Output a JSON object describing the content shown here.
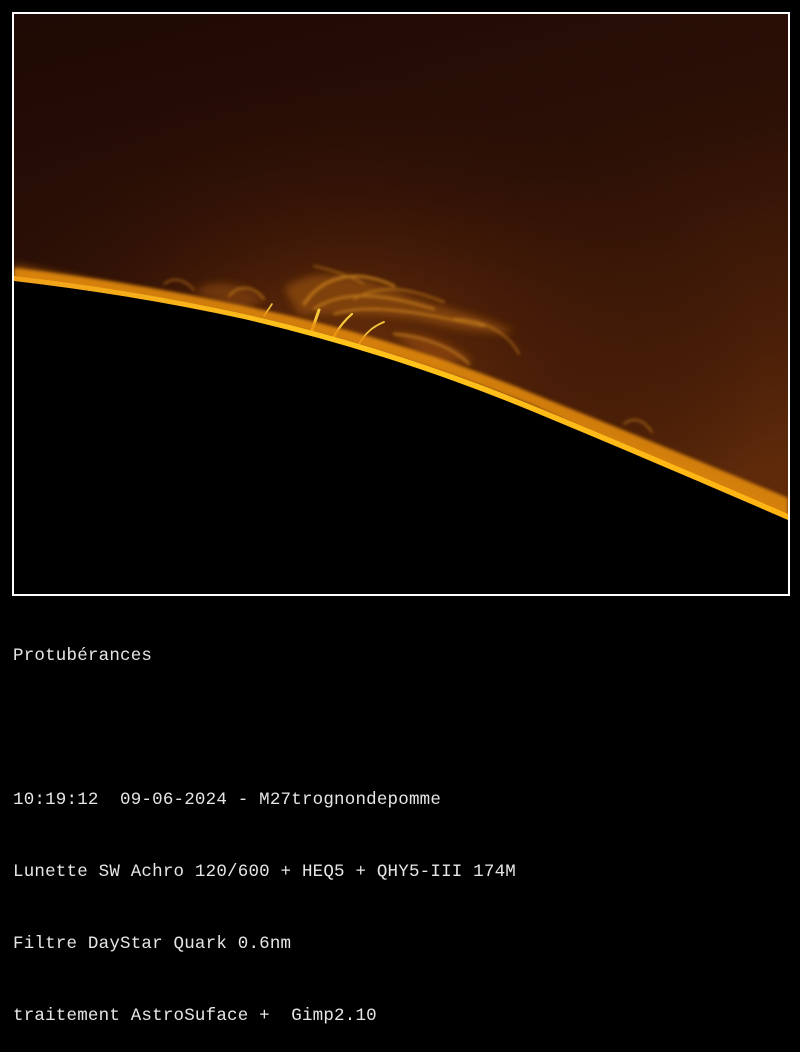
{
  "photo": {
    "subject": "solar-limb-prominences",
    "colors": {
      "sky_top": "#1a0804",
      "sky_glow": "#5a2a0c",
      "limb_bright": "#ffc21a",
      "limb_mid": "#e0890a",
      "disc": "#000000",
      "frame_border": "#ffffff"
    }
  },
  "caption": {
    "title": "Protubérances",
    "datetime_line": "10:19:12  09-06-2024 - M27trognondepomme",
    "equipment_line": "Lunette SW Achro 120/600 + HEQ5 + QHY5-III 174M",
    "filter_line": "Filtre DayStar Quark 0.6nm",
    "processing_line": "traitement AstroSuface +  Gimp2.10"
  }
}
